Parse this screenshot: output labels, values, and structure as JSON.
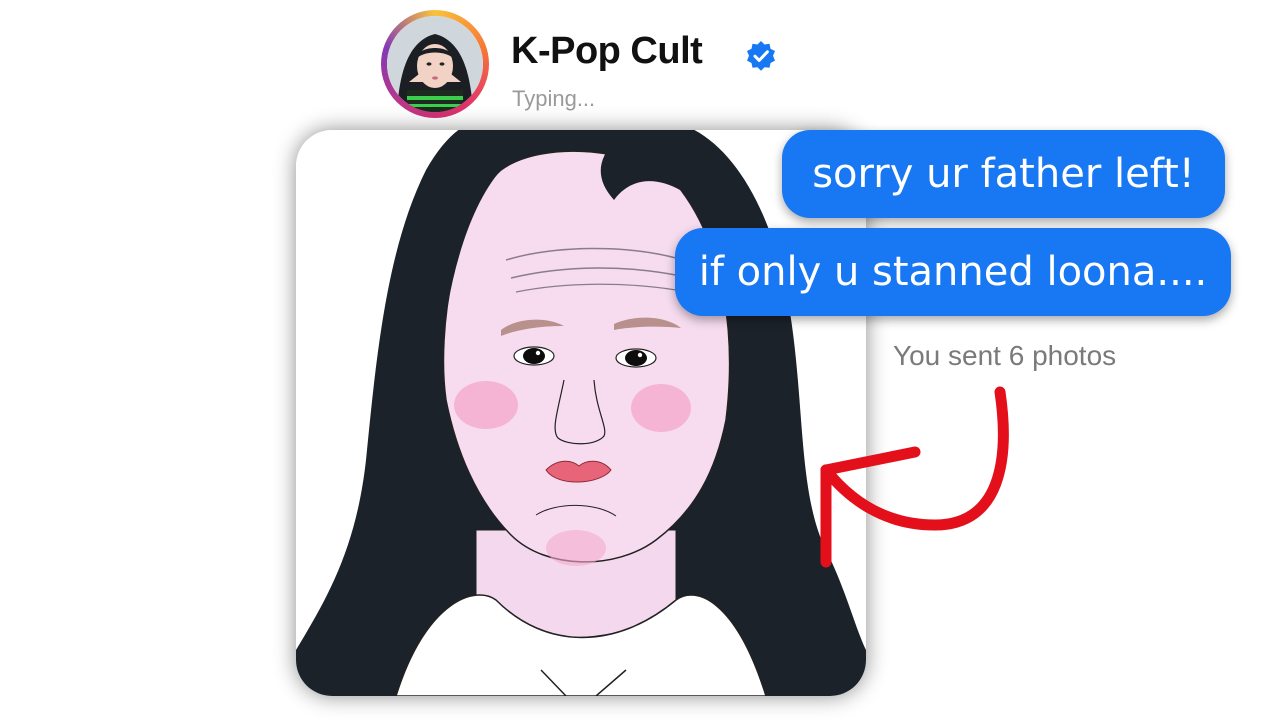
{
  "header": {
    "contact_name": "K-Pop Cult",
    "status": "Typing..."
  },
  "messages": [
    {
      "text": "sorry ur father left!",
      "sender": "me"
    },
    {
      "text": "if only u stanned loona....",
      "sender": "me"
    }
  ],
  "photos_note": "You sent 6 photos",
  "icons": {
    "verified": "verified-badge-icon",
    "annotation": "red-curved-arrow"
  },
  "colors": {
    "bubble": "#1877f2",
    "verified": "#1877f2",
    "arrow": "#e3101b",
    "hair": "#1b222a",
    "skin": "#f7dcf0"
  }
}
